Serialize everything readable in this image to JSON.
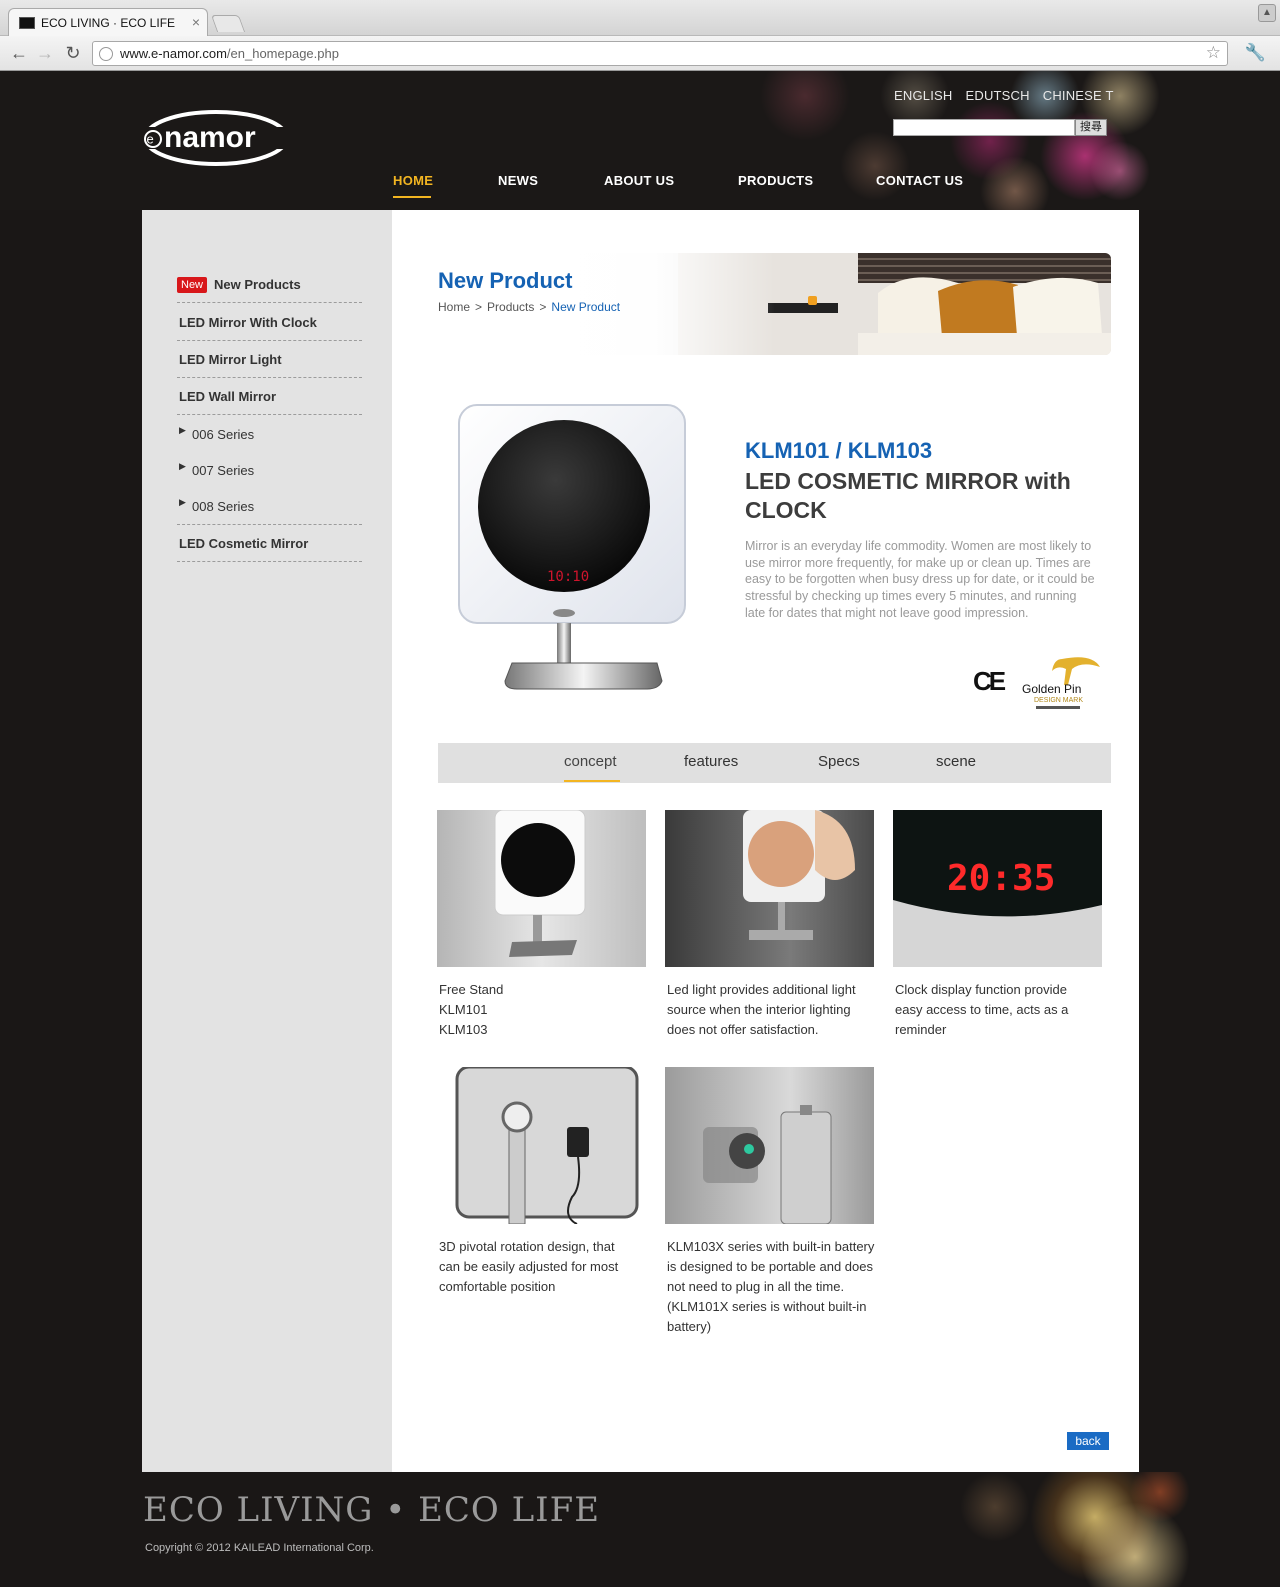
{
  "browser": {
    "tab_title": "ECO LIVING · ECO LIFE",
    "url_host": "www.e-namor.com",
    "url_path": "/en_homepage.php"
  },
  "header": {
    "languages": [
      "ENGLISH",
      "EDUTSCH",
      "CHINESE T"
    ],
    "search_button": "搜尋",
    "nav": [
      "HOME",
      "NEWS",
      "ABOUT US",
      "PRODUCTS",
      "CONTACT US"
    ],
    "active_nav": "HOME",
    "logo_text": "enamor"
  },
  "sidebar": {
    "new_badge": "New",
    "items": [
      {
        "label": "New Products"
      },
      {
        "label": "LED Mirror With Clock"
      },
      {
        "label": "LED Mirror Light"
      },
      {
        "label": "LED Wall Mirror"
      },
      {
        "label": "006 Series"
      },
      {
        "label": "007 Series"
      },
      {
        "label": "008 Series"
      },
      {
        "label": "LED Cosmetic Mirror"
      }
    ]
  },
  "banner": {
    "title": "New Product",
    "breadcrumb": [
      "Home",
      "Products",
      "New Product"
    ],
    "separator": ">"
  },
  "product": {
    "model": "KLM101 / KLM103",
    "title": "LED COSMETIC MIRROR with CLOCK",
    "description": "Mirror is an everyday life commodity. Women are most likely to use mirror more frequently, for make up or clean up. Times are easy to be forgotten when busy dress up for date, or it could be stressful by checking up times every 5 minutes, and running late for dates that might not leave good impression.",
    "clock_display": "10:10",
    "cert_ce": "CE",
    "cert_golden_pin": "Golden Pin",
    "cert_design_mark": "DESIGN MARK"
  },
  "tabs": {
    "items": [
      "concept",
      "features",
      "Specs",
      "scene"
    ],
    "active": "concept"
  },
  "gallery": [
    {
      "caption": "Free Stand\nKLM101\nKLM103"
    },
    {
      "caption": "Led light provides additional light source when the interior lighting does not offer satisfaction."
    },
    {
      "caption": "Clock display function provide easy access to time, acts as a reminder",
      "clock": "20:35"
    },
    {
      "caption": "3D pivotal rotation design, that can be easily adjusted for most comfortable position"
    },
    {
      "caption": "KLM103X series with built-in battery is designed to be portable and does not need to plug in all the time. (KLM101X series is without built-in battery)"
    }
  ],
  "back_label": "back",
  "footer": {
    "slogan": "ECO LIVING • ECO LIFE",
    "copyright": "Copyright ©  2012 KAILEAD International Corp."
  },
  "colors": {
    "accent_blue": "#1562b3",
    "nav_active": "#f3b521",
    "new_badge": "#d8171a",
    "header_bg": "#1b1817"
  }
}
